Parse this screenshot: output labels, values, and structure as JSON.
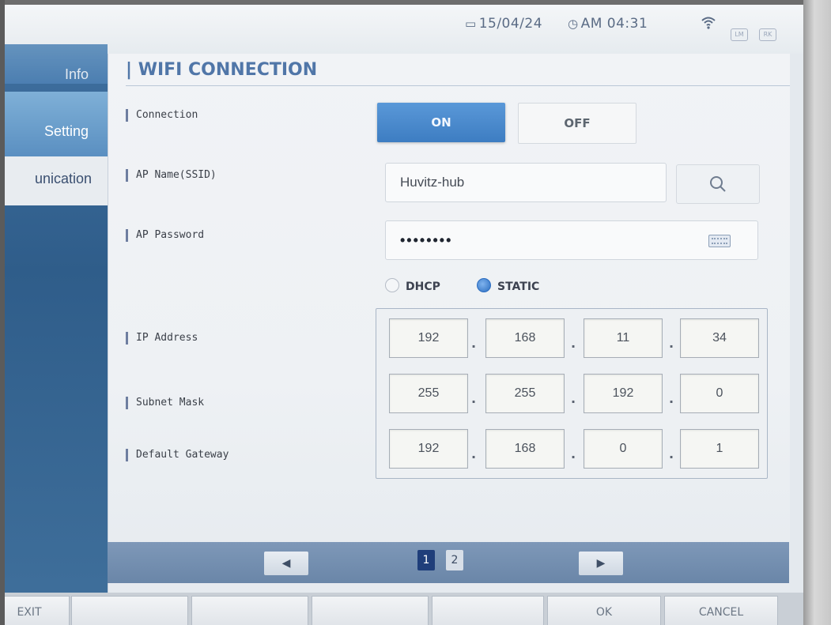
{
  "status": {
    "date": "15/04/24",
    "time": "AM 04:31",
    "lm_badge": "LM",
    "rk_badge": "RK"
  },
  "sidebar": {
    "items": [
      {
        "label": "Info"
      },
      {
        "label": "Setting"
      },
      {
        "label": "unication"
      }
    ]
  },
  "panel": {
    "title": "| WIFI CONNECTION"
  },
  "rows": {
    "connection_label": "Connection",
    "ssid_label": "AP Name(SSID)",
    "password_label": "AP Password",
    "ip_label": "IP Address",
    "subnet_label": "Subnet Mask",
    "gateway_label": "Default Gateway"
  },
  "connection": {
    "on_label": "ON",
    "off_label": "OFF",
    "selected": "ON"
  },
  "ssid": {
    "value": "Huvitz-hub"
  },
  "password": {
    "value": "••••••••"
  },
  "mode": {
    "dhcp_label": "DHCP",
    "static_label": "STATIC",
    "selected": "STATIC"
  },
  "ip": {
    "address": [
      "192",
      "168",
      "11",
      "34"
    ],
    "subnet": [
      "255",
      "255",
      "192",
      "0"
    ],
    "gateway": [
      "192",
      "168",
      "0",
      "1"
    ]
  },
  "pager": {
    "pages": [
      "1",
      "2"
    ],
    "current": "1",
    "prev_glyph": "◀",
    "next_glyph": "▶"
  },
  "bottom": {
    "buttons": [
      "EXIT",
      "",
      "",
      "",
      "",
      "OK",
      "CANCEL"
    ]
  },
  "colors": {
    "accent": "#3d7dc2",
    "title": "#5076a8",
    "sidebar": "#2f5d8a"
  }
}
